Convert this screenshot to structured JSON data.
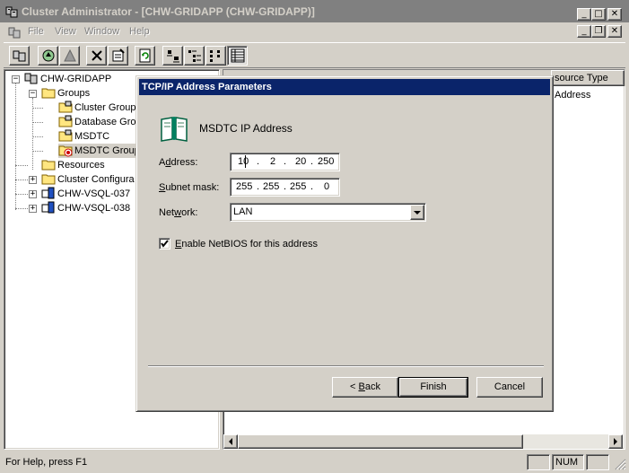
{
  "window": {
    "title": "Cluster Administrator - [CHW-GRIDAPP (CHW-GRIDAPP)]",
    "minimize_glyph": "_",
    "maximize_glyph": "□",
    "close_glyph": "✕",
    "doc_restore_glyph": "❐"
  },
  "menu": {
    "file": "File",
    "view": "View",
    "window": "Window",
    "help": "Help"
  },
  "toolbar_icons": [
    "cluster-connect-icon",
    "bring-online-icon",
    "take-offline-icon",
    "delete-icon",
    "properties-icon",
    "refresh-icon",
    "large-icons-icon",
    "small-icons-icon",
    "list-icon",
    "details-icon"
  ],
  "tree": {
    "root": "CHW-GRIDAPP",
    "groups": "Groups",
    "group_items": [
      "Cluster Group",
      "Database Gro",
      "MSDTC",
      "MSDTC Group"
    ],
    "resources": "Resources",
    "cluster_config": "Cluster Configura",
    "node1": "CHW-VSQL-037",
    "node2": "CHW-VSQL-038"
  },
  "right_pane": {
    "column_header": "source Type",
    "row_value": "Address"
  },
  "statusbar": {
    "help_text": "For Help, press F1",
    "num": "NUM"
  },
  "dialog": {
    "title": "TCP/IP Address Parameters",
    "resource_name": "MSDTC IP Address",
    "address_label_pre": "A",
    "address_label_ul": "d",
    "address_label_post": "dress:",
    "address": [
      "10",
      "2",
      "20",
      "250"
    ],
    "subnet_label_pre": "",
    "subnet_label_ul": "S",
    "subnet_label_post": "ubnet mask:",
    "subnet": [
      "255",
      "255",
      "255",
      "0"
    ],
    "network_label_pre": "Net",
    "network_label_ul": "w",
    "network_label_post": "ork:",
    "network_value": "LAN",
    "netbios_checked": true,
    "netbios_label_ul": "E",
    "netbios_label_post": "nable NetBIOS for this address",
    "dot": ".",
    "back_pre": "< ",
    "back_ul": "B",
    "back_post": "ack",
    "finish_label": "Finish",
    "cancel_label": "Cancel"
  }
}
